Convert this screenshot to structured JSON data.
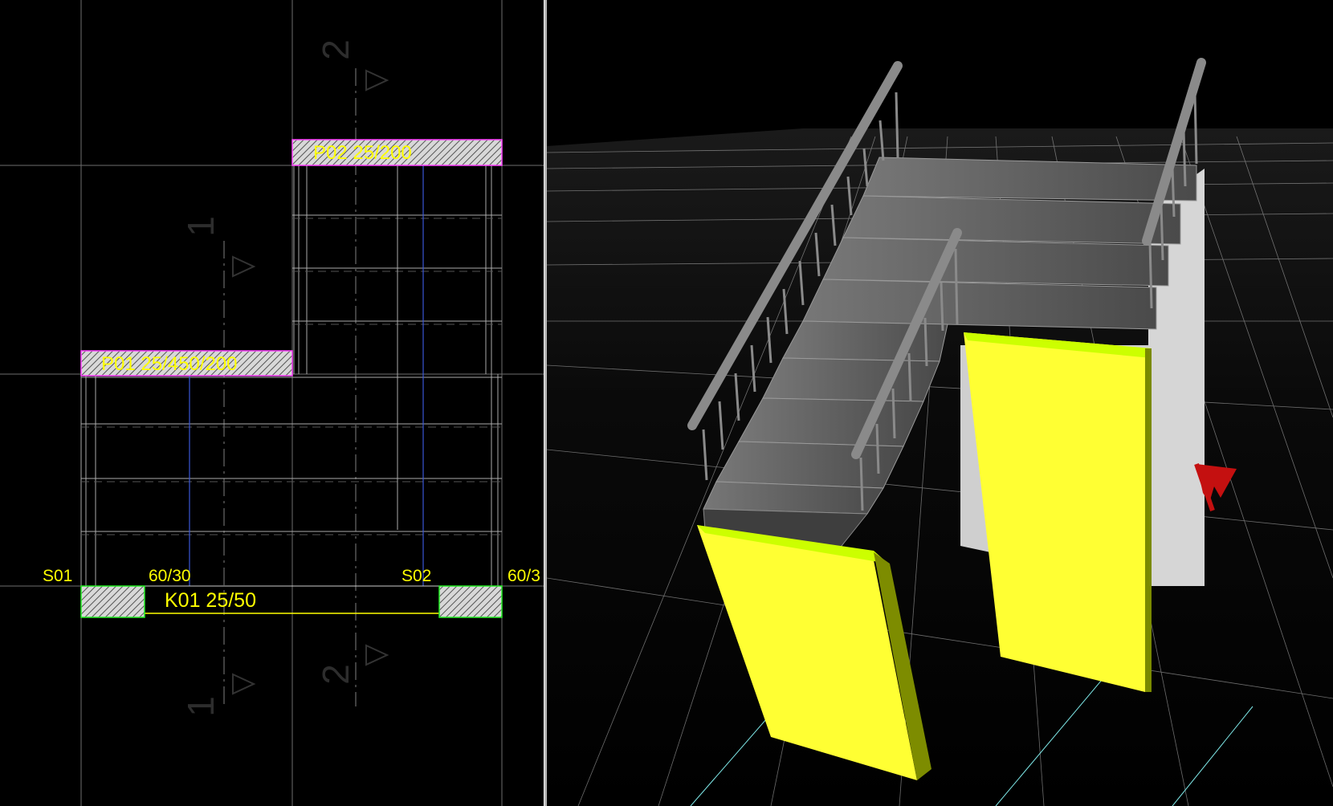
{
  "plan": {
    "columns": [
      {
        "id": "S01",
        "size": "60/30"
      },
      {
        "id": "S02",
        "size": "60/3"
      }
    ],
    "slabs": [
      {
        "label": "P01 25/450/200"
      },
      {
        "label": "P02 25/200"
      }
    ],
    "beam": {
      "label": "K01 25/50"
    },
    "section_marks": [
      "1",
      "1",
      "2",
      "2"
    ]
  },
  "colors": {
    "background": "#000000",
    "label": "#ffff00",
    "slab_hatch_border": "#ff00ff",
    "column_hatch_border": "#00ff00",
    "wall_3d": "#ffff33",
    "stair_3d": "#5a5a5a",
    "axis_marker": "#cc0000"
  }
}
